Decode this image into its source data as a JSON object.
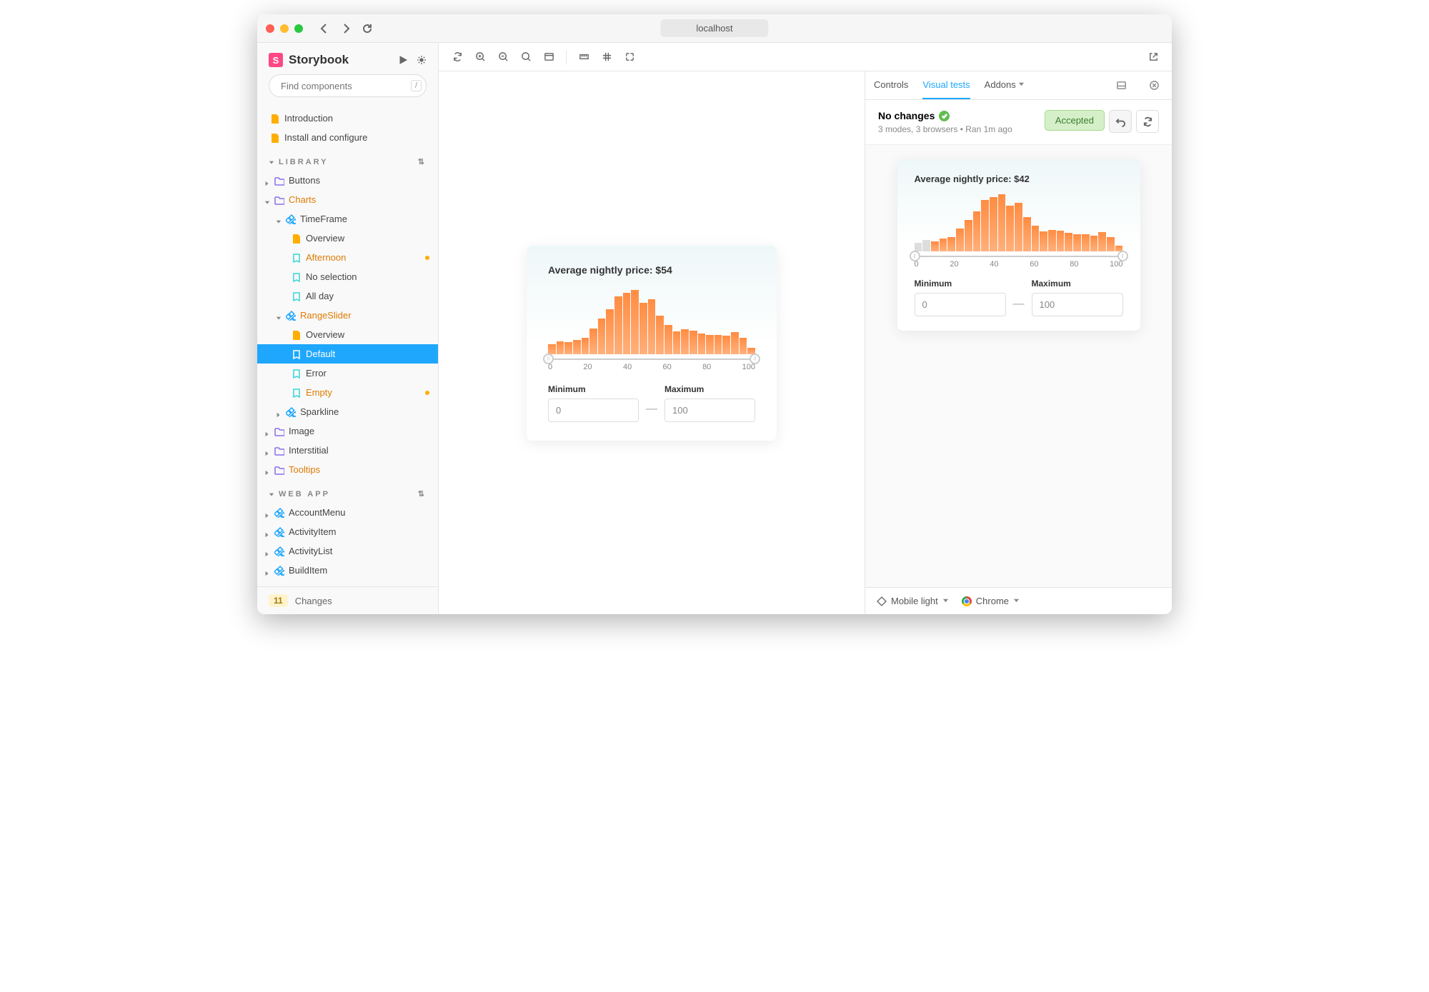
{
  "titlebar": {
    "url": "localhost"
  },
  "brand": {
    "name": "Storybook"
  },
  "search": {
    "placeholder": "Find components",
    "shortcut": "/"
  },
  "sections": {
    "docs": [
      "Introduction",
      "Install and configure"
    ],
    "library_label": "LIBRARY",
    "webapp_label": "WEB APP"
  },
  "tree": {
    "buttons": "Buttons",
    "charts": "Charts",
    "timeframe": "TimeFrame",
    "tf_overview": "Overview",
    "tf_afternoon": "Afternoon",
    "tf_noselection": "No selection",
    "tf_allday": "All day",
    "rangeslider": "RangeSlider",
    "rs_overview": "Overview",
    "rs_default": "Default",
    "rs_error": "Error",
    "rs_empty": "Empty",
    "sparkline": "Sparkline",
    "image": "Image",
    "interstitial": "Interstitial",
    "tooltips": "Tooltips",
    "accountmenu": "AccountMenu",
    "activityitem": "ActivityItem",
    "activitylist": "ActivityList",
    "builditem": "BuildItem"
  },
  "changes": {
    "count": "11",
    "label": "Changes"
  },
  "panel": {
    "tabs": {
      "controls": "Controls",
      "visual": "Visual tests",
      "addons": "Addons"
    },
    "status_title": "No changes",
    "status_sub": "3 modes, 3 browsers • Ran 1m ago",
    "accepted": "Accepted",
    "footer_mode": "Mobile light",
    "footer_browser": "Chrome"
  },
  "card_main": {
    "title": "Average nightly price: $54",
    "min_label": "Minimum",
    "max_label": "Maximum",
    "min_value": "0",
    "max_value": "100",
    "ticks": [
      "0",
      "20",
      "40",
      "60",
      "80",
      "100"
    ]
  },
  "card_side": {
    "title": "Average nightly price: $42",
    "min_label": "Minimum",
    "max_label": "Maximum",
    "min_value": "0",
    "max_value": "100",
    "ticks": [
      "0",
      "20",
      "40",
      "60",
      "80",
      "100"
    ]
  },
  "chart_data": [
    {
      "type": "bar",
      "title": "Average nightly price: $54",
      "xlabel": "",
      "ylabel": "",
      "x_range": [
        0,
        100
      ],
      "ticks": [
        0,
        20,
        40,
        60,
        80,
        100
      ],
      "values": [
        15,
        20,
        18,
        22,
        25,
        40,
        55,
        70,
        90,
        95,
        100,
        80,
        85,
        60,
        45,
        35,
        38,
        36,
        32,
        30,
        30,
        28,
        34,
        25,
        10
      ],
      "inputs": {
        "minimum": 0,
        "maximum": 100
      }
    },
    {
      "type": "bar",
      "title": "Average nightly price: $42",
      "xlabel": "",
      "ylabel": "",
      "x_range": [
        0,
        100
      ],
      "ticks": [
        0,
        20,
        40,
        60,
        80,
        100
      ],
      "muted_indices": [
        0,
        1
      ],
      "values": [
        15,
        20,
        18,
        22,
        25,
        40,
        55,
        70,
        90,
        95,
        100,
        80,
        85,
        60,
        45,
        35,
        38,
        36,
        32,
        30,
        30,
        28,
        34,
        25,
        10
      ],
      "inputs": {
        "minimum": 0,
        "maximum": 100
      }
    }
  ]
}
